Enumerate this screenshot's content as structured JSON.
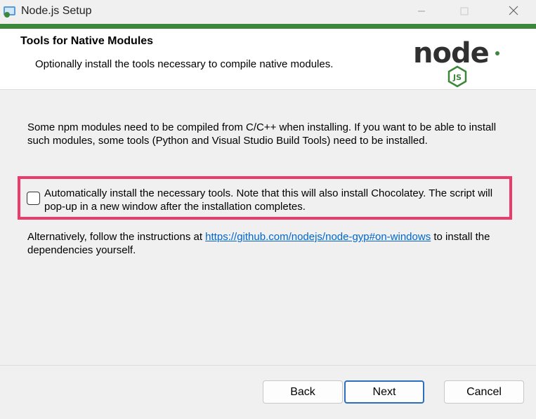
{
  "window": {
    "title": "Node.js Setup"
  },
  "colors": {
    "accent": "#3c873a",
    "highlight": "#ee3a6a",
    "link": "#0066cc"
  },
  "header": {
    "title": "Tools for Native Modules",
    "subtitle": "Optionally install the tools necessary to compile native modules.",
    "logo_text": "node",
    "logo_badge": "JS"
  },
  "body": {
    "intro": "Some npm modules need to be compiled from C/C++ when installing. If you want to be able to install such modules, some tools (Python and Visual Studio Build Tools) need to be installed.",
    "checkbox": {
      "label": "Automatically install the necessary tools. Note that this will also install Chocolatey. The script will pop-up in a new window after the installation completes.",
      "checked": false
    },
    "alternative_prefix": "Alternatively, follow the instructions at ",
    "alternative_link": "https://github.com/nodejs/node-gyp#on-windows",
    "alternative_suffix": " to install the dependencies yourself."
  },
  "buttons": {
    "back": "Back",
    "next": "Next",
    "cancel": "Cancel"
  }
}
